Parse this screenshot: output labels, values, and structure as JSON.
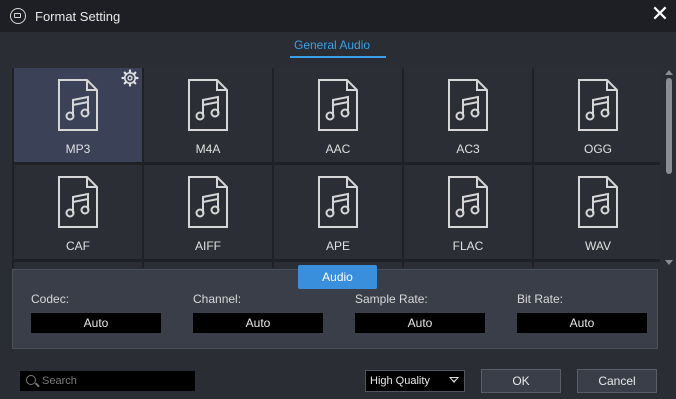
{
  "window": {
    "title": "Format Setting",
    "close_label": "✕"
  },
  "tabs": {
    "general_audio": "General Audio"
  },
  "formats": [
    {
      "label": "MP3",
      "selected": true
    },
    {
      "label": "M4A"
    },
    {
      "label": "AAC"
    },
    {
      "label": "AC3"
    },
    {
      "label": "OGG"
    },
    {
      "label": "CAF"
    },
    {
      "label": "AIFF"
    },
    {
      "label": "APE"
    },
    {
      "label": "FLAC"
    },
    {
      "label": "WAV"
    }
  ],
  "panel": {
    "tab_label": "Audio",
    "codec": {
      "label": "Codec:",
      "value": "Auto"
    },
    "channel": {
      "label": "Channel:",
      "value": "Auto"
    },
    "sample_rate": {
      "label": "Sample Rate:",
      "value": "Auto"
    },
    "bit_rate": {
      "label": "Bit Rate:",
      "value": "Auto"
    }
  },
  "footer": {
    "search_placeholder": "Search",
    "quality": "High Quality",
    "ok_label": "OK",
    "cancel_label": "Cancel"
  },
  "colors": {
    "accent": "#3aa0e8",
    "selected_tile": "#3b4157",
    "audio_tab": "#3a8fdd"
  },
  "icons": {
    "app": "video-converter-icon",
    "tile": "music-file-icon",
    "settings": "gear-icon",
    "search": "search-icon"
  }
}
